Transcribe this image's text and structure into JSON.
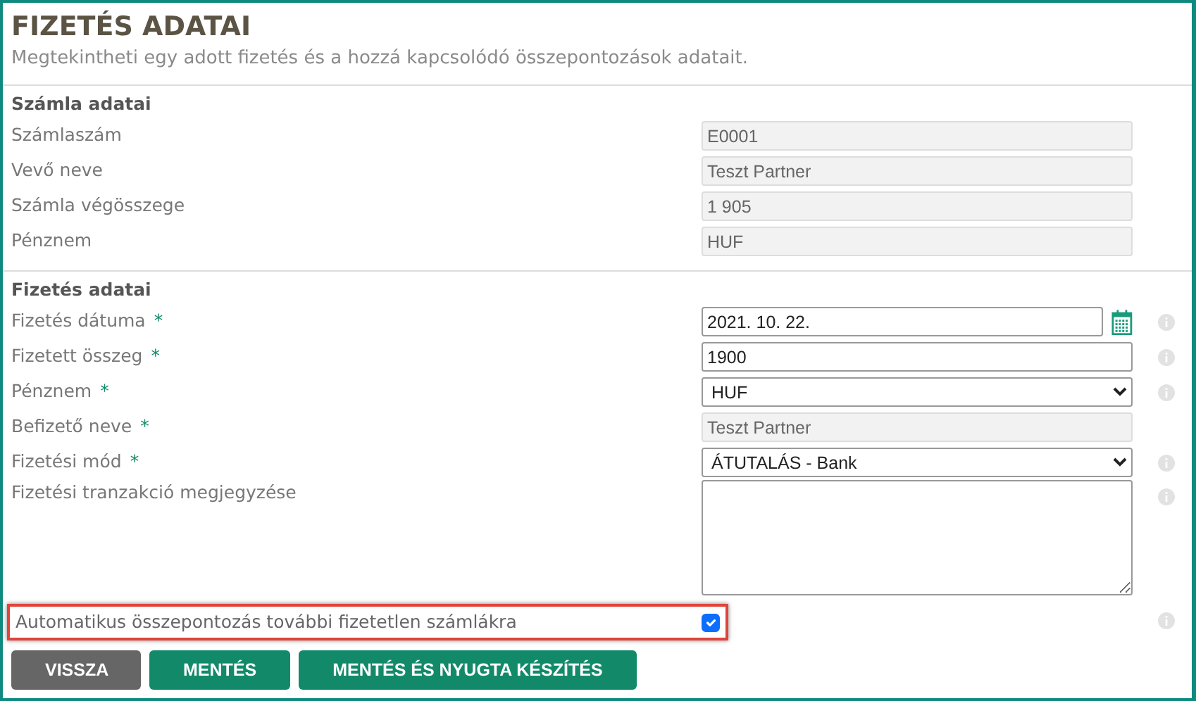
{
  "title": "FIZETÉS ADATAI",
  "subtitle": "Megtekintheti egy adott fizetés és a hozzá kapcsolódó összepontozások adatait.",
  "sections": [
    {
      "heading": "Számla adatai",
      "fields": [
        {
          "label": "Számlaszám",
          "kind": "readonly",
          "value": "E0001",
          "info": false
        },
        {
          "label": "Vevő neve",
          "kind": "readonly",
          "value": "Teszt Partner",
          "info": false
        },
        {
          "label": "Számla végösszege",
          "kind": "readonly",
          "value": "1 905",
          "info": false
        },
        {
          "label": "Pénznem",
          "kind": "readonly",
          "value": "HUF",
          "info": false
        }
      ]
    },
    {
      "heading": "Fizetés adatai",
      "fields": [
        {
          "label": "Fizetés dátuma",
          "required_mark": "*",
          "kind": "date",
          "value": "2021. 10. 22.",
          "info": true
        },
        {
          "label": "Fizetett összeg",
          "required_mark": "*",
          "kind": "text",
          "value": "1900",
          "info": true
        },
        {
          "label": "Pénznem",
          "required_mark": "*",
          "kind": "select",
          "value": "HUF",
          "info": true
        },
        {
          "label": "Befizető neve",
          "required_mark": "*",
          "kind": "readonly",
          "value": "Teszt Partner",
          "info": false
        },
        {
          "label": "Fizetési mód",
          "required_mark": "*",
          "kind": "select",
          "value": "ÁTUTALÁS - Bank",
          "info": true
        },
        {
          "label": "Fizetési tranzakció megjegyzése",
          "kind": "textarea",
          "info": true
        }
      ]
    }
  ],
  "auto_option": {
    "label": "Automatikus összepontozás további fizetetlen számlákra",
    "checked": true,
    "highlighted": true,
    "info": true
  },
  "buttons": [
    {
      "label": "VISSZA",
      "kind": "secondary"
    },
    {
      "label": "MENTÉS",
      "kind": "primary"
    },
    {
      "label": "MENTÉS ÉS NYUGTA KÉSZÍTÉS",
      "kind": "primary"
    }
  ]
}
